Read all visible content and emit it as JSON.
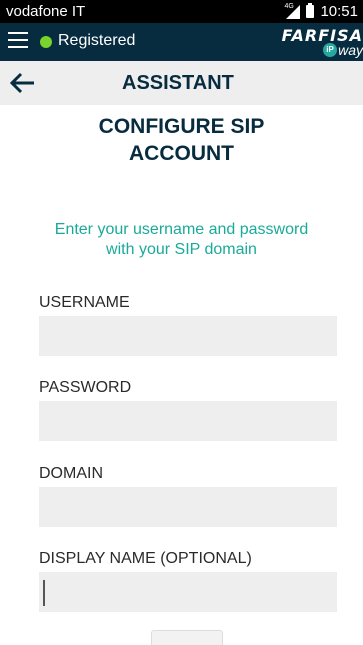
{
  "status_bar": {
    "carrier": "vodafone IT",
    "network": "4G",
    "time": "10:51"
  },
  "app_bar": {
    "status_label": "Registered",
    "status_color": "#79d32a",
    "brand_name": "FARFISA",
    "brand_badge": "iP",
    "brand_suffix": "way",
    "background": "#072c3f"
  },
  "title_bar": {
    "title": "ASSISTANT"
  },
  "content": {
    "heading_line1": "CONFIGURE SIP",
    "heading_line2": "ACCOUNT",
    "subtitle_line1": "Enter your username and password",
    "subtitle_line2": "with your SIP domain",
    "accent_color": "#1aaa9a"
  },
  "form": {
    "username": {
      "label": "USERNAME",
      "value": ""
    },
    "password": {
      "label": "PASSWORD",
      "value": ""
    },
    "domain": {
      "label": "DOMAIN",
      "value": ""
    },
    "display_name": {
      "label": "DISPLAY NAME (OPTIONAL)",
      "value": ""
    }
  },
  "icons": {
    "menu": "menu-icon",
    "back": "back-arrow-icon",
    "signal": "signal-icon",
    "battery": "battery-icon"
  }
}
